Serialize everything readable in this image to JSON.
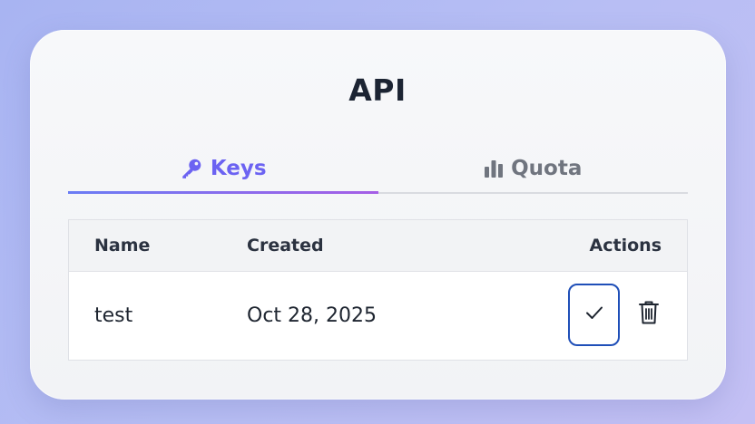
{
  "title": "API",
  "tabs": [
    {
      "label": "Keys",
      "icon": "key-icon",
      "active": true
    },
    {
      "label": "Quota",
      "icon": "bar-chart-icon",
      "active": false
    }
  ],
  "table": {
    "headers": {
      "name": "Name",
      "created": "Created",
      "actions": "Actions"
    },
    "rows": [
      {
        "name": "test",
        "created": "Oct 28, 2025"
      }
    ]
  },
  "colors": {
    "accent": "#6c63f2",
    "focus_border": "#1f4fb8"
  }
}
